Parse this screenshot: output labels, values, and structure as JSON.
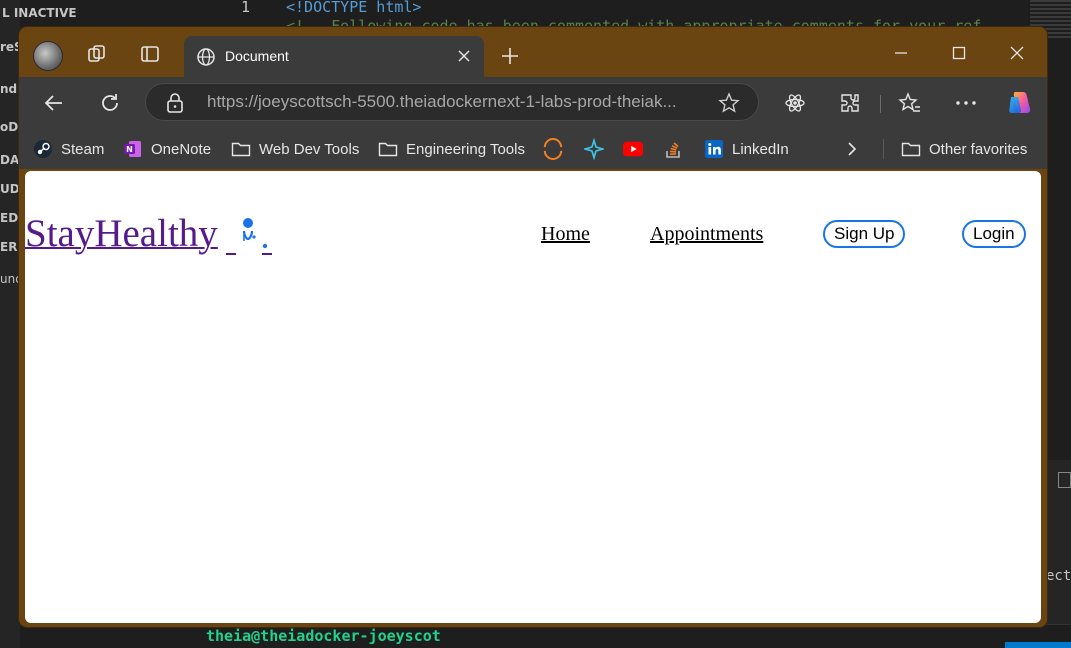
{
  "ide": {
    "sidebar_labels": [
      "L  INACTIVE",
      "reS",
      "ndr",
      "oD",
      "DAT",
      "UD",
      "EDI",
      "ER",
      "und"
    ],
    "line_number": "1",
    "code_line": "<!DOCTYPE html>",
    "code_line_2": "<!-- Following code has been commented with appropriate comments for your ref",
    "terminal_prompt": "theia@theiadocker-joeyscot",
    "right_fragment": "ect"
  },
  "browser": {
    "tab": {
      "title": "Document"
    },
    "address": {
      "url": "https://joeyscottsch-5500.theiadockernext-1-labs-prod-theiak..."
    },
    "bookmarks": [
      {
        "label": "Steam",
        "icon": "steam-icon"
      },
      {
        "label": "OneNote",
        "icon": "onenote-icon"
      },
      {
        "label": "Web Dev Tools",
        "icon": "folder-icon"
      },
      {
        "label": "Engineering Tools",
        "icon": "folder-icon"
      },
      {
        "label": "",
        "icon": "orange-arc-icon"
      },
      {
        "label": "",
        "icon": "sparkle-icon"
      },
      {
        "label": "",
        "icon": "youtube-icon"
      },
      {
        "label": "",
        "icon": "stackoverflow-icon"
      },
      {
        "label": "LinkedIn",
        "icon": "linkedin-icon"
      }
    ],
    "other_favorites": "Other favorites",
    "colors": {
      "frame": "#6b4511",
      "toolbar": "#3b3b3b",
      "accent": "#1a73e8"
    }
  },
  "page": {
    "logo_text": "StayHealthy",
    "nav": {
      "home": "Home",
      "appointments": "Appointments",
      "signup": "Sign Up",
      "login": "Login"
    },
    "colors": {
      "logo": "#551a8b",
      "button_border": "#1a73e8"
    }
  }
}
